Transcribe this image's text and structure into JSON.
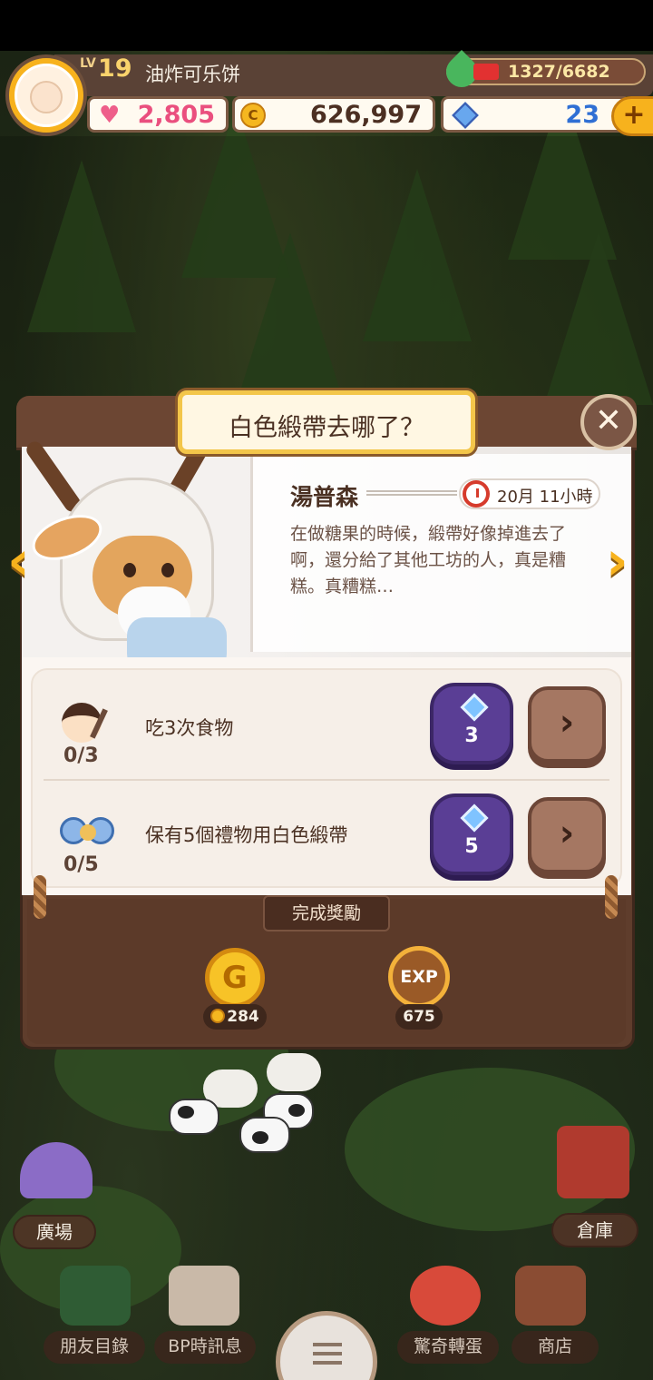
{
  "player": {
    "level_prefix": "LV",
    "level": "19",
    "name": "油炸可乐饼",
    "energy": "1327/6682",
    "hearts": "2,805",
    "coins": "626,997",
    "gems": "23",
    "add_label": "+"
  },
  "quest": {
    "title": "白色緞帶去哪了？",
    "close_label": "✕",
    "speaker": "湯普森",
    "timer": "20月 11小時",
    "dialogue": "在做糖果的時候，緞帶好像掉進去了啊，還分給了其他工坊的人，真是糟糕。真糟糕…",
    "prev_label": "‹",
    "next_label": "›",
    "tasks": [
      {
        "text": "吃3次食物",
        "progress": "0/3",
        "reward": "3",
        "go_label": "›"
      },
      {
        "text": "保有5個禮物用白色緞帶",
        "progress": "0/5",
        "reward": "5",
        "go_label": "›"
      }
    ],
    "completion_label": "完成獎勵",
    "rewards": {
      "coin_icon_label": "G",
      "coin_value": "284",
      "exp_icon_label": "EXP",
      "exp_value": "675"
    }
  },
  "world": {
    "plaza_label": "廣場",
    "warehouse_label": "倉庫"
  },
  "bottom_nav": [
    {
      "label": "朋友目錄"
    },
    {
      "label": "BP時訊息"
    },
    {
      "label": "驚奇轉蛋"
    },
    {
      "label": "商店"
    }
  ],
  "colors": {
    "accent_gold": "#f7b21d",
    "panel_brown": "#5f3d2c",
    "gem_badge": "#5a3e95",
    "heart_pink": "#ea4f7e"
  }
}
